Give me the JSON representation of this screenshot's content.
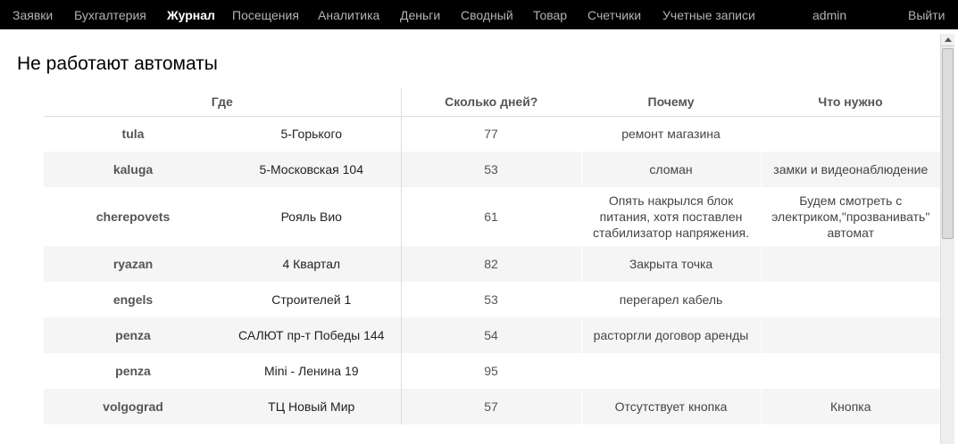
{
  "nav": {
    "items": [
      {
        "label": "Заявки",
        "active": false
      },
      {
        "label": "Бухгалтерия",
        "active": false
      },
      {
        "label": "Журнал",
        "active": true
      },
      {
        "label": "Посещения",
        "active": false
      },
      {
        "label": "Аналитика",
        "active": false
      },
      {
        "label": "Деньги",
        "active": false
      },
      {
        "label": "Сводный",
        "active": false
      },
      {
        "label": "Товар",
        "active": false
      },
      {
        "label": "Счетчики",
        "active": false
      },
      {
        "label": "Учетные записи",
        "active": false
      }
    ],
    "user": "admin",
    "logout": "Выйти"
  },
  "page": {
    "title": "Не работают автоматы"
  },
  "table": {
    "headers": {
      "where": "Где",
      "days": "Сколько дней?",
      "reason": "Почему",
      "need": "Что нужно"
    },
    "rows": [
      {
        "city": "tula",
        "address": "5-Горького",
        "days": "77",
        "reason": "ремонт магазина",
        "need": ""
      },
      {
        "city": "kaluga",
        "address": "5-Московская 104",
        "days": "53",
        "reason": "сломан",
        "need": "замки и видеонаблюдение"
      },
      {
        "city": "cherepovets",
        "address": "Рояль Вио",
        "days": "61",
        "reason": "Опять накрылся блок питания, хотя поставлен стабилизатор напряжения.",
        "need": "Будем смотреть с электриком,\"прозванивать\" автомат"
      },
      {
        "city": "ryazan",
        "address": "4 Квартал",
        "days": "82",
        "reason": "Закрыта точка",
        "need": ""
      },
      {
        "city": "engels",
        "address": "Строителей 1",
        "days": "53",
        "reason": "перегарел кабель",
        "need": ""
      },
      {
        "city": "penza",
        "address": "САЛЮТ пр-т Победы 144",
        "days": "54",
        "reason": "расторгли договор аренды",
        "need": ""
      },
      {
        "city": "penza",
        "address": "Mini - Ленина 19",
        "days": "95",
        "reason": "",
        "need": ""
      },
      {
        "city": "volgograd",
        "address": "ТЦ Новый Мир",
        "days": "57",
        "reason": "Отсутствует кнопка",
        "need": "Кнопка"
      }
    ]
  }
}
